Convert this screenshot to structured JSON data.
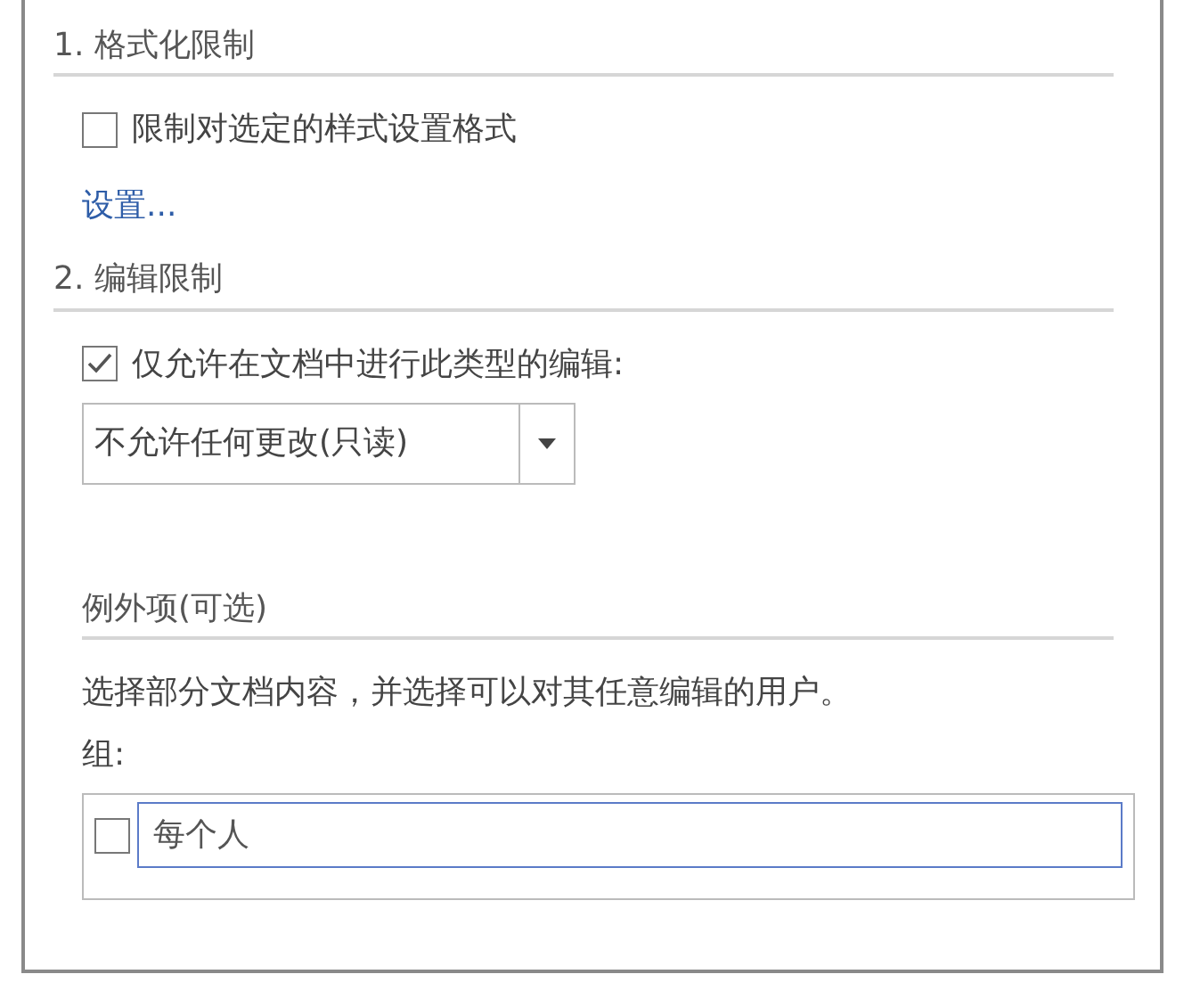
{
  "formatting": {
    "heading": "1. 格式化限制",
    "checkbox": {
      "label": "限制对选定的样式设置格式",
      "checked": false
    },
    "link": "设置..."
  },
  "editing": {
    "heading": "2. 编辑限制",
    "checkbox": {
      "label": "仅允许在文档中进行此类型的编辑:",
      "checked": true
    },
    "dropdown": {
      "value": "不允许任何更改(只读)"
    }
  },
  "exceptions": {
    "heading": "例外项(可选)",
    "description": "选择部分文档内容，并选择可以对其任意编辑的用户。",
    "groups_label": "组:",
    "groups": [
      {
        "label": "每个人",
        "checked": false,
        "selected": true
      }
    ]
  }
}
